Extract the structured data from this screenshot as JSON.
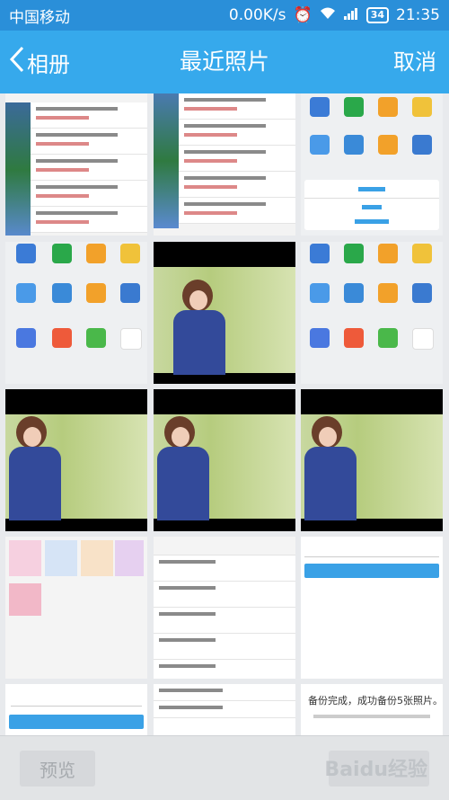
{
  "status_bar": {
    "carrier": "中国移动",
    "speed": "0.00K/s",
    "battery": "34",
    "time": "21:35"
  },
  "nav": {
    "back_label": "相册",
    "title": "最近照片",
    "cancel_label": "取消"
  },
  "thumb_text": {
    "backup_done": "备份完成，成功备份5张照片。"
  },
  "bottom": {
    "preview_label": "预览",
    "watermark": "Baidu经验"
  },
  "colors": {
    "status_bar": "#2a8fd9",
    "nav_bar": "#36a9ec",
    "accent": "#3aa1e6"
  }
}
